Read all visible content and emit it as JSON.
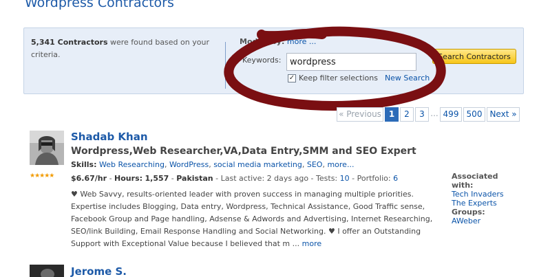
{
  "page": {
    "title": "Wordpress Contractors"
  },
  "filter_panel": {
    "count": "5,341 Contractors",
    "count_suffix": "were found based on your criteria.",
    "modify_label": "Modify by:",
    "modify_more": "more ...",
    "keywords_label": "Keywords:",
    "keywords_value": "wordpress",
    "keep_filter_label": "Keep filter selections",
    "keep_filter_checked": true,
    "new_search": "New Search",
    "search_button": "Search Contractors"
  },
  "annotation": {
    "color": "#7a0f12",
    "shape": "hand-drawn ellipse around search controls"
  },
  "pagination": {
    "previous": "« Previous",
    "pages": [
      "1",
      "2",
      "3",
      "...",
      "499",
      "500"
    ],
    "current": "1",
    "next": "Next »"
  },
  "contractors": [
    {
      "name": "Shadab Khan",
      "headline": "Wordpress,Web Researcher,VA,Data Entry,SMM and SEO Expert",
      "skills_label": "Skills:",
      "skills": [
        "Web Researching",
        "WordPress",
        "social media marketing",
        "SEO"
      ],
      "skills_more": "more...",
      "rating_stars": "★★★★★",
      "rate": "$6.67/hr",
      "hours_label": "Hours:",
      "hours": "1,557",
      "location": "Pakistan",
      "last_active": "Last active: 2 days ago",
      "tests_label": "Tests:",
      "tests": "10",
      "portfolio_label": "Portfolio:",
      "portfolio": "6",
      "description": "♥ Web Savvy, results-oriented leader with proven success in managing multiple priorities. Expertise includes Blogging, Data entry, Wordpress, Technical Assistance, Good Traffic sense, Facebook Group and Page handling, Adsense & Adwords and Advertising, Internet Researching, SEO/link Building, Email Response Handling and Social Networking. ♥ I offer an Outstanding Support with Exceptional Value because I believed that m ...",
      "description_more": "more",
      "associated_label": "Associated with:",
      "associated": [
        "Tech Invaders",
        "The Experts"
      ],
      "groups_label": "Groups:",
      "groups": [
        "AWeber"
      ]
    },
    {
      "name": "Jerome S."
    }
  ]
}
